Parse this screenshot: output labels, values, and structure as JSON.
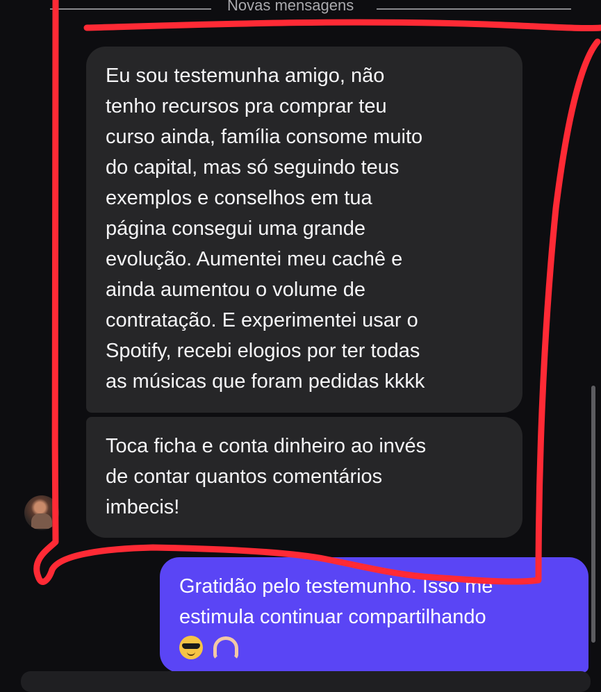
{
  "divider": {
    "label": "Novas mensagens"
  },
  "messages": [
    {
      "direction": "incoming",
      "text": "Eu sou testemunha amigo, não\ntenho recursos pra comprar teu\ncurso ainda, família consome muito\ndo capital, mas só seguindo teus\nexemplos e conselhos em tua\npágina consegui uma grande\nevolução. Aumentei meu cachê e\nainda aumentou o volume de\ncontratação. E experimentei usar o\nSpotify, recebi elogios por ter todas\nas músicas que foram pedidas kkkk"
    },
    {
      "direction": "incoming",
      "text": "Toca ficha e conta dinheiro ao invés\nde contar quantos comentários\nimbecis!"
    },
    {
      "direction": "outgoing",
      "text": "Gratidão pelo testemunho. Isso me\nestimula continuar compartilhando",
      "emojis": [
        "smiling-face-with-sunglasses-icon",
        "heart-hands-icon"
      ]
    }
  ],
  "colors": {
    "background": "#0d0d10",
    "incoming_bubble": "#262628",
    "outgoing_bubble": "#5a45f5",
    "annotation_stroke": "#ff2a35"
  }
}
